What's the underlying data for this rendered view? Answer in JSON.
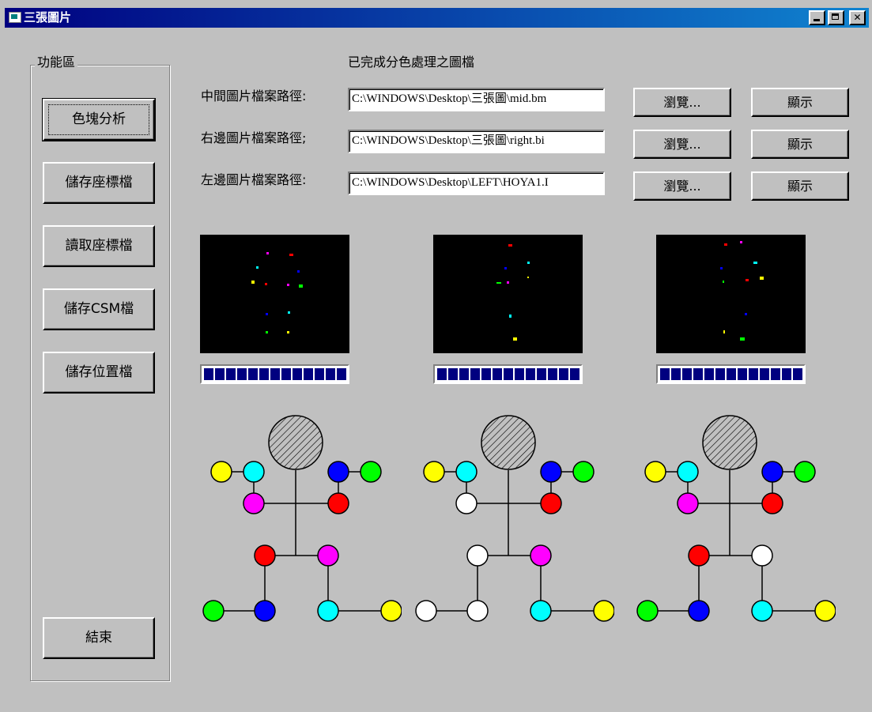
{
  "window": {
    "title": "三張圖片"
  },
  "sidebar": {
    "group_label": "功能區",
    "buttons": [
      "色塊分析",
      "儲存座標檔",
      "讀取座標檔",
      "儲存CSM檔",
      "儲存位置檔"
    ],
    "exit_label": "結束"
  },
  "header": {
    "title": "已完成分色處理之圖檔"
  },
  "paths": [
    {
      "label": "中間圖片檔案路徑:",
      "value": "C:\\WINDOWS\\Desktop\\三張圖\\mid.bm",
      "browse": "瀏覽...",
      "show": "顯示"
    },
    {
      "label": "右邊圖片檔案路徑;",
      "value": "C:\\WINDOWS\\Desktop\\三張圖\\right.bi",
      "browse": "瀏覽...",
      "show": "顯示"
    },
    {
      "label": "左邊圖片檔案路徑:",
      "value": "C:\\WINDOWS\\Desktop\\LEFT\\HOYA1.I",
      "browse": "瀏覽...",
      "show": "顯示"
    }
  ],
  "progress": [
    1,
    1,
    1
  ],
  "colors": {
    "accent": "#000080",
    "yellow": "#ffff00",
    "cyan": "#00ffff",
    "blue": "#0000ff",
    "green": "#00ff00",
    "magenta": "#ff00ff",
    "red": "#ff0000",
    "white": "#ffffff"
  },
  "figures": [
    {
      "left_outer": "yellow",
      "left_inner": "cyan",
      "right_inner": "blue",
      "right_outer": "green",
      "left_elbow": "magenta",
      "right_elbow": "red",
      "left_hip": "red",
      "right_hip": "magenta",
      "left_knee": "blue",
      "right_knee": "cyan",
      "left_foot": "green",
      "right_foot": "yellow"
    },
    {
      "left_outer": "yellow",
      "left_inner": "cyan",
      "right_inner": "blue",
      "right_outer": "green",
      "left_elbow": "white",
      "right_elbow": "red",
      "left_hip": "white",
      "right_hip": "magenta",
      "left_knee": "white",
      "right_knee": "cyan",
      "left_foot": "white",
      "right_foot": "yellow"
    },
    {
      "left_outer": "yellow",
      "left_inner": "cyan",
      "right_inner": "blue",
      "right_outer": "green",
      "left_elbow": "magenta",
      "right_elbow": "red",
      "left_hip": "red",
      "right_hip": "white",
      "left_knee": "blue",
      "right_knee": "cyan",
      "left_foot": "green",
      "right_foot": "yellow"
    }
  ]
}
